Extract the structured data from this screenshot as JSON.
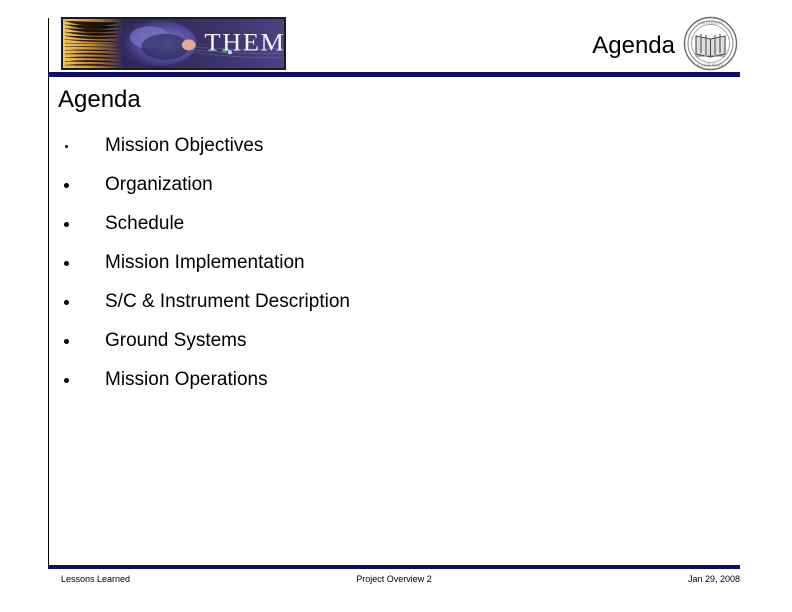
{
  "slide": {
    "header": {
      "title": "Agenda",
      "logo_alt": "THEMIS",
      "logo_wordmark": "THEMIS",
      "seal_name": "university-seal"
    },
    "heading": "Agenda",
    "bullets": [
      {
        "label": "Mission Objectives",
        "marker": "small-dot"
      },
      {
        "label": "Organization",
        "marker": "dot"
      },
      {
        "label": "Schedule",
        "marker": "dot"
      },
      {
        "label": "Mission Implementation",
        "marker": "dot"
      },
      {
        "label": "S/C & Instrument Description",
        "marker": "dot"
      },
      {
        "label": "Ground Systems",
        "marker": "dot"
      },
      {
        "label": "Mission Operations",
        "marker": "dot"
      }
    ],
    "footer": {
      "left": "Lessons Learned",
      "center": "Project Overview 2",
      "right": "Jan 29, 2008"
    },
    "colors": {
      "rule": "#0d0d6b",
      "text": "#000000",
      "background": "#ffffff",
      "logo_purple": "#4a4490",
      "logo_amber": "#e8a23c"
    }
  }
}
